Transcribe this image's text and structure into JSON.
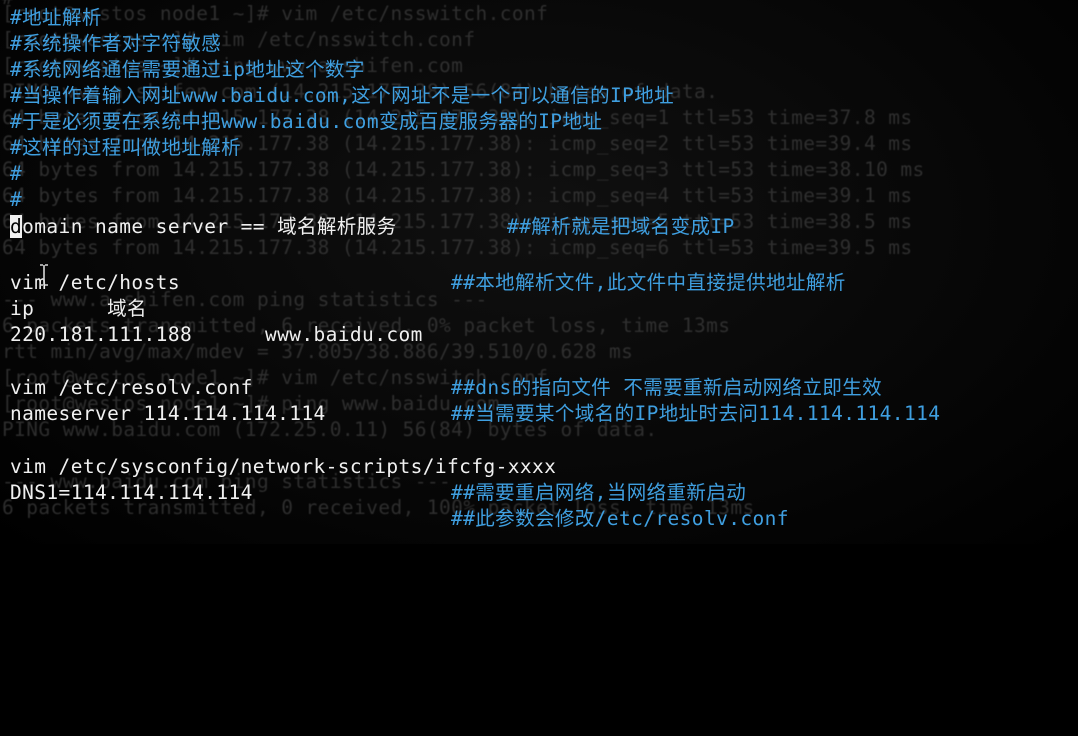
{
  "window": {
    "title": "terminal - vim"
  },
  "background_output": [
    "#",
    "[root@westos node1 ~]# vim /etc/nsswitch.conf",
    "[root@westos ~]# vim /etc/nsswitch.conf",
    "[root@westos ~]# ping www.a.shifen.com",
    "PING www.a.shifen.com (14.215.177.38) 56(84) bytes of data.",
    "64 bytes from 14.215.177.38 (14.215.177.38): icmp_seq=1 ttl=53 time=37.8 ms",
    "64 bytes from 14.215.177.38 (14.215.177.38): icmp_seq=2 ttl=53 time=39.4 ms",
    "64 bytes from 14.215.177.38 (14.215.177.38): icmp_seq=3 ttl=53 time=38.10 ms",
    "64 bytes from 14.215.177.38 (14.215.177.38): icmp_seq=4 ttl=53 time=39.1 ms",
    "64 bytes from 14.215.177.38 (14.215.177.38): icmp_seq=5 ttl=53 time=38.5 ms",
    "64 bytes from 14.215.177.38 (14.215.177.38): icmp_seq=6 ttl=53 time=39.5 ms",
    "",
    "--- www.a.shifen.com ping statistics ---",
    "6 packets transmitted, 6 received, 0% packet loss, time 13ms",
    "rtt min/avg/max/mdev = 37.805/38.886/39.510/0.628 ms",
    "[root@westos node1 ~]# vim /etc/nsswitch.conf",
    "[root@westos node1 ~]# ping www.baidu.com",
    "PING www.baidu.com (172.25.0.11) 56(84) bytes of data.",
    "",
    "--- www.baidu.com ping statistics ---",
    "6 packets transmitted, 0 received, 100% packet loss, time 13ms"
  ],
  "lines": {
    "l00": "#地址解析",
    "l01": "#系统操作者对字符敏感",
    "l02": "#系统网络通信需要通过ip地址这个数字",
    "l03": "#当操作着输入网址www.baidu.com,这个网址不是一个可以通信的IP地址",
    "l04": "#于是必须要在系统中把www.baidu.com变成百度服务器的IP地址",
    "l05": "#这样的过程叫做地址解析",
    "l06": "#",
    "l07": "#",
    "l08_cursor": "d",
    "l08_text": "omain name server == 域名解析服务",
    "l08_comment": "##解析就是把域名变成IP",
    "l10_text": "vim /etc/hosts",
    "l10_comment": "##本地解析文件,此文件中直接提供地址解析",
    "l11_text": "ip      域名",
    "l12_text": "220.181.111.188      www.baidu.com",
    "l14_text": "vim /etc/resolv.conf",
    "l14_comment": "##dns的指向文件 不需要重新启动网络立即生效",
    "l15_text": "nameserver 114.114.114.114",
    "l15_comment": "##当需要某个域名的IP地址时去问114.114.114.114",
    "l17_text": "vim /etc/sysconfig/network-scripts/ifcfg-xxxx",
    "l18_text": "DNS1=114.114.114.114",
    "l18_comment": "##需要重启网络,当网络重新启动",
    "l19_comment": "##此参数会修改/etc/resolv.conf"
  },
  "colors": {
    "background": "#000000",
    "comment": "#3f9fe0",
    "text": "#f0f0f0",
    "ghost_text": "#3a3a3a"
  },
  "icons": {
    "mouse_pointer": "i-beam-cursor-icon"
  }
}
